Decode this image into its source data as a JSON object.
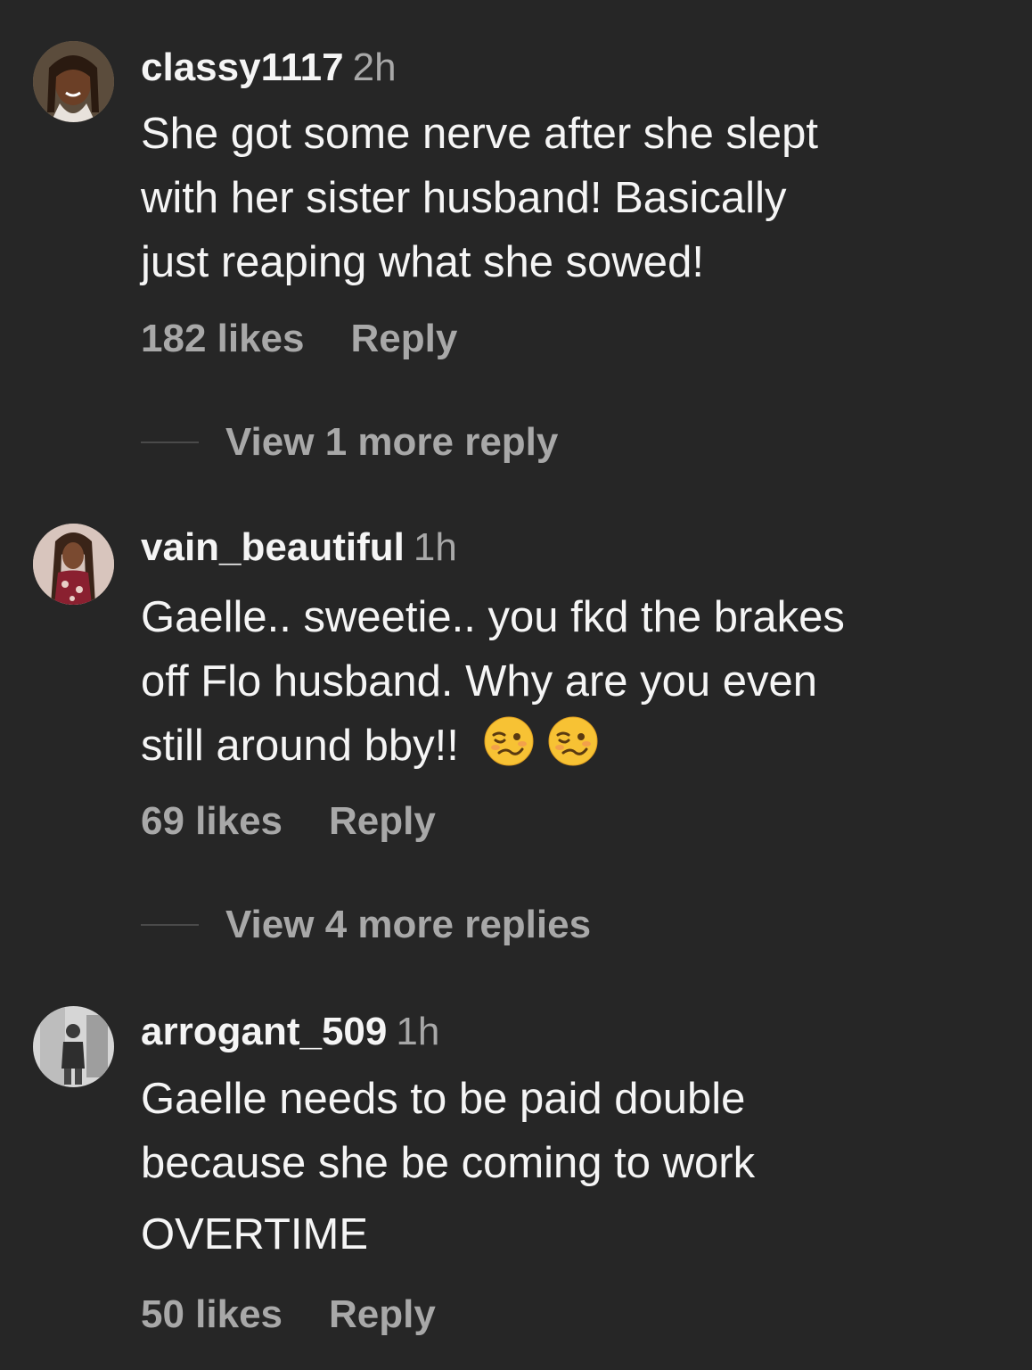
{
  "comments": [
    {
      "username": "classy1117",
      "time": "2h",
      "lines": [
        "She got some nerve after she slept",
        "with her sister husband! Basically",
        "just reaping what she sowed!"
      ],
      "likes": "182 likes",
      "reply_label": "Reply",
      "view_replies": "View 1 more reply"
    },
    {
      "username": "vain_beautiful",
      "time": "1h",
      "lines": [
        "Gaelle.. sweetie.. you fkd the brakes",
        "off Flo husband. Why are you even",
        "still around bby!!"
      ],
      "emojis": [
        "woozy-face-emoji",
        "woozy-face-emoji"
      ],
      "likes": "69 likes",
      "reply_label": "Reply",
      "view_replies": "View 4 more replies"
    },
    {
      "username": "arrogant_509",
      "time": "1h",
      "lines": [
        "Gaelle needs to be paid double",
        "because she be coming to work",
        "OVERTIME"
      ],
      "likes": "50 likes",
      "reply_label": "Reply"
    }
  ],
  "colors": {
    "background": "#262626",
    "primary_text": "#f5f5f5",
    "secondary_text": "#a8a8a8"
  }
}
